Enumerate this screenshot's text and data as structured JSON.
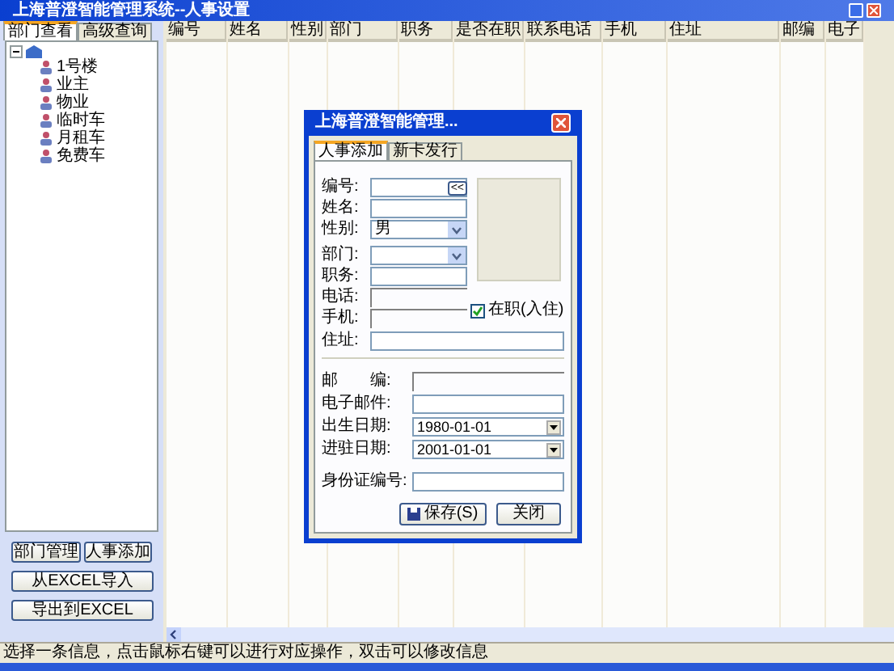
{
  "window": {
    "title": "上海普澄智能管理系统--人事设置"
  },
  "left_tabs": [
    {
      "label": "部门查看",
      "selected": true
    },
    {
      "label": "高级查询",
      "selected": false
    }
  ],
  "tree": {
    "expanded": true,
    "children": [
      {
        "label": "1号楼"
      },
      {
        "label": "业主"
      },
      {
        "label": "物业"
      },
      {
        "label": "临时车"
      },
      {
        "label": "月租车"
      },
      {
        "label": "免费车"
      }
    ]
  },
  "left_buttons": [
    "部门管理",
    "人事添加",
    "从EXCEL导入",
    "导出到EXCEL"
  ],
  "table": {
    "columns": [
      "编号",
      "姓名",
      "性别",
      "部门",
      "职务",
      "是否在职",
      "联系电话",
      "手机",
      "住址",
      "邮编",
      "电子"
    ]
  },
  "status_bar": "选择一条信息，点击鼠标右键可以进行对应操作，双击可以修改信息",
  "dialog": {
    "title": "上海普澄智能管理...",
    "tabs": [
      {
        "label": "人事添加",
        "selected": true
      },
      {
        "label": "新卡发行",
        "selected": false
      }
    ],
    "fields": [
      {
        "label": "编号:",
        "kind": "button",
        "button": "<<"
      },
      {
        "label": "姓名:",
        "kind": "text"
      },
      {
        "label": "性别:",
        "kind": "combo",
        "value": "男"
      },
      {
        "label": "部门:",
        "kind": "combo"
      },
      {
        "label": "职务:",
        "kind": "text"
      },
      {
        "label": "电话:",
        "kind": "line"
      },
      {
        "label": "手机:",
        "kind": "line"
      }
    ],
    "address": {
      "label": "住址:"
    },
    "employed": {
      "label": "在职(入住)",
      "checked": true
    },
    "lower_fields": [
      {
        "label": "邮　　编:",
        "kind": "line"
      },
      {
        "label": "电子邮件:",
        "kind": "text"
      },
      {
        "label": "出生日期:",
        "kind": "date",
        "value": "1980-01-01"
      },
      {
        "label": "进驻日期:",
        "kind": "date",
        "value": "2001-01-01"
      },
      {
        "label": "身份证编号:",
        "kind": "text"
      }
    ],
    "buttons": [
      {
        "label": "保存(S)",
        "kind": "save"
      },
      {
        "label": "关闭",
        "kind": "plain"
      }
    ]
  }
}
